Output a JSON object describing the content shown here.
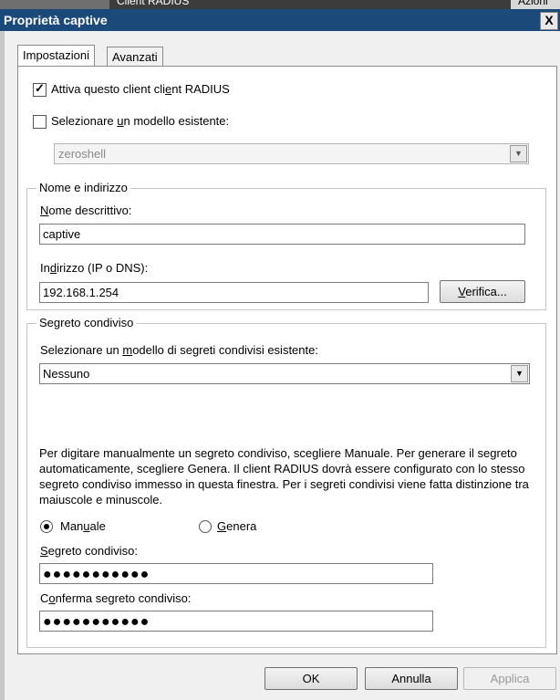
{
  "background_window": {
    "text_left": "Client RADIUS",
    "text_right": "Azioni"
  },
  "window": {
    "title": "Proprietà captive",
    "close_glyph": "X"
  },
  "tabs": [
    {
      "label": "Impostazioni"
    },
    {
      "label": "Avanzati"
    }
  ],
  "enable_client": {
    "checked": true,
    "label_pre": "Attiva questo client",
    "label_u": "e",
    "label_post": "nt RADIUS",
    "label_cli": "cli"
  },
  "use_template": {
    "checked": false,
    "label_pre": "Selezionare ",
    "label_u": "u",
    "label_post": "n modello esistente:"
  },
  "template_select": {
    "value": "zeroshell"
  },
  "name_group": {
    "title": "Nome e indirizzo",
    "friendly_label_u": "N",
    "friendly_label_rest": "ome descrittivo:",
    "friendly_value": "captive",
    "address_label_pre": "In",
    "address_label_u": "d",
    "address_label_post": "irizzo (IP o DNS):",
    "address_value": "192.168.1.254",
    "verify_u": "V",
    "verify_rest": "erifica..."
  },
  "secret_group": {
    "title": "Segreto condiviso",
    "template_label_pre": "Selezionare un ",
    "template_label_u": "m",
    "template_label_post": "odello di segreti condivisi esistente:",
    "template_value": "Nessuno",
    "description": "Per digitare manualmente un segreto condiviso, scegliere Manuale. Per generare il segreto automaticamente, scegliere Genera. Il client RADIUS dovrà essere configurato con lo stesso segreto condiviso immesso in questa finestra. Per i segreti condivisi viene fatta distinzione tra maiuscole e minuscole.",
    "manual_pre": "Man",
    "manual_u": "u",
    "manual_post": "ale",
    "manual_selected": true,
    "generate_u": "G",
    "generate_rest": "enera",
    "secret_label_u": "S",
    "secret_label_rest": "egreto condiviso:",
    "secret_value": "●●●●●●●●●●●",
    "confirm_label_pre": "C",
    "confirm_label_u": "o",
    "confirm_label_post": "nferma segreto condiviso:",
    "confirm_value": "●●●●●●●●●●●"
  },
  "buttons": {
    "ok": "OK",
    "cancel": "Annulla",
    "apply": "Applica"
  }
}
